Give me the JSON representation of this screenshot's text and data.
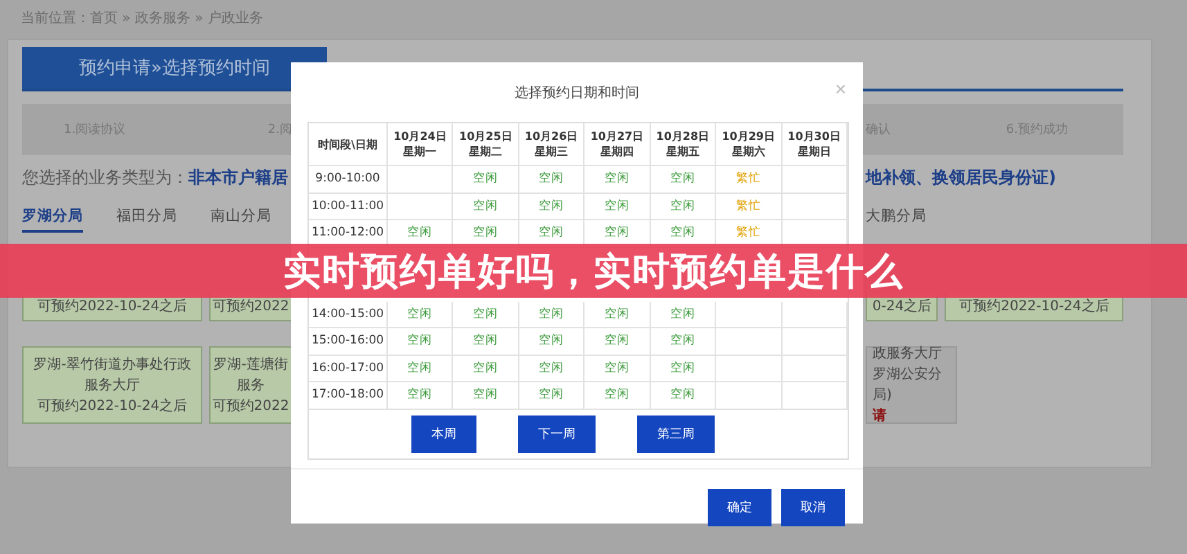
{
  "breadcrumb": "当前位置：首页 » 政务服务 » 户政业务",
  "page_header": "预约申请»选择预约时间",
  "steps": {
    "left": [
      "1.阅读协议",
      "2.阅"
    ],
    "right": [
      "确认",
      "6.预约成功"
    ]
  },
  "business_type": {
    "label": "您选择的业务类型为：",
    "value_start": "非本市户籍居",
    "value_end": "地补领、换领居民身份证)"
  },
  "branch_tabs": {
    "left": [
      {
        "label": "罗湖分局",
        "selected": true
      },
      {
        "label": "福田分局",
        "selected": false
      },
      {
        "label": "南山分局",
        "selected": false
      }
    ],
    "right": [
      {
        "label": "大鹏分局",
        "selected": false
      }
    ]
  },
  "service_cards": {
    "left": [
      [
        {
          "kind": "open",
          "lines": [
            "可预约2022-10-24之后"
          ]
        },
        {
          "kind": "open",
          "lines": [
            "可预约2022"
          ]
        }
      ],
      [
        {
          "kind": "open",
          "lines": [
            "罗湖-翠竹街道办事处行政",
            "服务大厅",
            "可预约2022-10-24之后"
          ]
        },
        {
          "kind": "open",
          "lines": [
            "罗湖-莲塘街",
            "服务",
            "可预约2022"
          ]
        }
      ]
    ],
    "right": [
      [
        {
          "kind": "open",
          "lines": [
            "0-24之后"
          ]
        },
        {
          "kind": "open",
          "lines": [
            "可预约2022-10-24之后"
          ]
        }
      ],
      [
        {
          "kind": "closed",
          "lines": [
            "政服务大厅",
            "罗湖公安分",
            "局)"
          ],
          "action": "请"
        }
      ]
    ]
  },
  "modal": {
    "title": "选择预约日期和时间",
    "close": "×",
    "corner": "时间段\\日期",
    "columns": [
      {
        "date": "10月24日",
        "weekday": "星期一"
      },
      {
        "date": "10月25日",
        "weekday": "星期二"
      },
      {
        "date": "10月26日",
        "weekday": "星期三"
      },
      {
        "date": "10月27日",
        "weekday": "星期四"
      },
      {
        "date": "10月28日",
        "weekday": "星期五"
      },
      {
        "date": "10月29日",
        "weekday": "星期六"
      },
      {
        "date": "10月30日",
        "weekday": "星期日"
      }
    ],
    "rows_above_banner": [
      {
        "time": "9:00-10:00",
        "cells": [
          {
            "kind": "empty"
          },
          {
            "kind": "free",
            "text": "空闲"
          },
          {
            "kind": "free",
            "text": "空闲"
          },
          {
            "kind": "free",
            "text": "空闲"
          },
          {
            "kind": "free",
            "text": "空闲"
          },
          {
            "kind": "busy",
            "text": "繁忙"
          },
          {
            "kind": "empty"
          }
        ]
      },
      {
        "time": "10:00-11:00",
        "cells": [
          {
            "kind": "empty"
          },
          {
            "kind": "free",
            "text": "空闲"
          },
          {
            "kind": "free",
            "text": "空闲"
          },
          {
            "kind": "free",
            "text": "空闲"
          },
          {
            "kind": "free",
            "text": "空闲"
          },
          {
            "kind": "busy",
            "text": "繁忙"
          },
          {
            "kind": "empty"
          }
        ]
      },
      {
        "time": "11:00-12:00",
        "cells": [
          {
            "kind": "free",
            "text": "空闲"
          },
          {
            "kind": "free",
            "text": "空闲"
          },
          {
            "kind": "free",
            "text": "空闲"
          },
          {
            "kind": "free",
            "text": "空闲"
          },
          {
            "kind": "free",
            "text": "空闲"
          },
          {
            "kind": "busy",
            "text": "繁忙"
          },
          {
            "kind": "empty"
          }
        ]
      }
    ],
    "rows_below_banner": [
      {
        "time": "14:00-15:00",
        "cells": [
          {
            "kind": "free",
            "text": "空闲"
          },
          {
            "kind": "free",
            "text": "空闲"
          },
          {
            "kind": "free",
            "text": "空闲"
          },
          {
            "kind": "free",
            "text": "空闲"
          },
          {
            "kind": "free",
            "text": "空闲"
          },
          {
            "kind": "empty"
          },
          {
            "kind": "empty"
          }
        ]
      },
      {
        "time": "15:00-16:00",
        "cells": [
          {
            "kind": "free",
            "text": "空闲"
          },
          {
            "kind": "free",
            "text": "空闲"
          },
          {
            "kind": "free",
            "text": "空闲"
          },
          {
            "kind": "free",
            "text": "空闲"
          },
          {
            "kind": "free",
            "text": "空闲"
          },
          {
            "kind": "empty"
          },
          {
            "kind": "empty"
          }
        ]
      },
      {
        "time": "16:00-17:00",
        "cells": [
          {
            "kind": "free",
            "text": "空闲"
          },
          {
            "kind": "free",
            "text": "空闲"
          },
          {
            "kind": "free",
            "text": "空闲"
          },
          {
            "kind": "free",
            "text": "空闲"
          },
          {
            "kind": "free",
            "text": "空闲"
          },
          {
            "kind": "empty"
          },
          {
            "kind": "empty"
          }
        ]
      },
      {
        "time": "17:00-18:00",
        "cells": [
          {
            "kind": "free",
            "text": "空闲"
          },
          {
            "kind": "free",
            "text": "空闲"
          },
          {
            "kind": "free",
            "text": "空闲"
          },
          {
            "kind": "free",
            "text": "空闲"
          },
          {
            "kind": "free",
            "text": "空闲"
          },
          {
            "kind": "empty"
          },
          {
            "kind": "empty"
          }
        ]
      }
    ],
    "week_buttons": [
      "本周",
      "下一周",
      "第三周"
    ],
    "footer_buttons": [
      "确定",
      "取消"
    ]
  },
  "banner": "实时预约单好吗，实时预约单是什么"
}
